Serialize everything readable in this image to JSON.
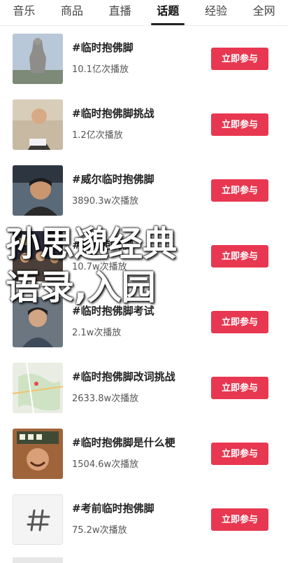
{
  "tabs": [
    {
      "label": "音乐"
    },
    {
      "label": "商品"
    },
    {
      "label": "直播"
    },
    {
      "label": "话题",
      "active": true
    },
    {
      "label": "经验"
    },
    {
      "label": "全网"
    }
  ],
  "topics": [
    {
      "title": "#临时抱佛脚",
      "plays": "10.1亿次播放",
      "button": "立即参与",
      "thumb_icon": "statue-photo-icon"
    },
    {
      "title": "#临时抱佛脚挑战",
      "plays": "1.2亿次播放",
      "button": "立即参与",
      "thumb_icon": "person-photo-icon"
    },
    {
      "title": "#威尔临时抱佛脚",
      "plays": "3890.3w次播放",
      "button": "立即参与",
      "thumb_icon": "person-photo-icon"
    },
    {
      "title": "#临时抱佛脚",
      "plays": "10.7w次播放",
      "button": "立即参与",
      "thumb_icon": "crowd-photo-icon"
    },
    {
      "title": "#临时抱佛脚考试",
      "plays": "2.1w次播放",
      "button": "立即参与",
      "thumb_icon": "person-photo-icon"
    },
    {
      "title": "#临时抱佛脚改词挑战",
      "plays": "2633.8w次播放",
      "button": "立即参与",
      "thumb_icon": "map-photo-icon"
    },
    {
      "title": "#临时抱佛脚是什么梗",
      "plays": "1504.6w次播放",
      "button": "立即参与",
      "thumb_icon": "person-photo-icon"
    },
    {
      "title": "#考前临时抱佛脚",
      "plays": "75.2w次播放",
      "button": "立即参与",
      "thumb_icon": "hashtag-icon"
    }
  ],
  "overlay": {
    "line1": "孙思邈经典",
    "line2": "语录,入园"
  },
  "colors": {
    "accent": "#e83750"
  }
}
